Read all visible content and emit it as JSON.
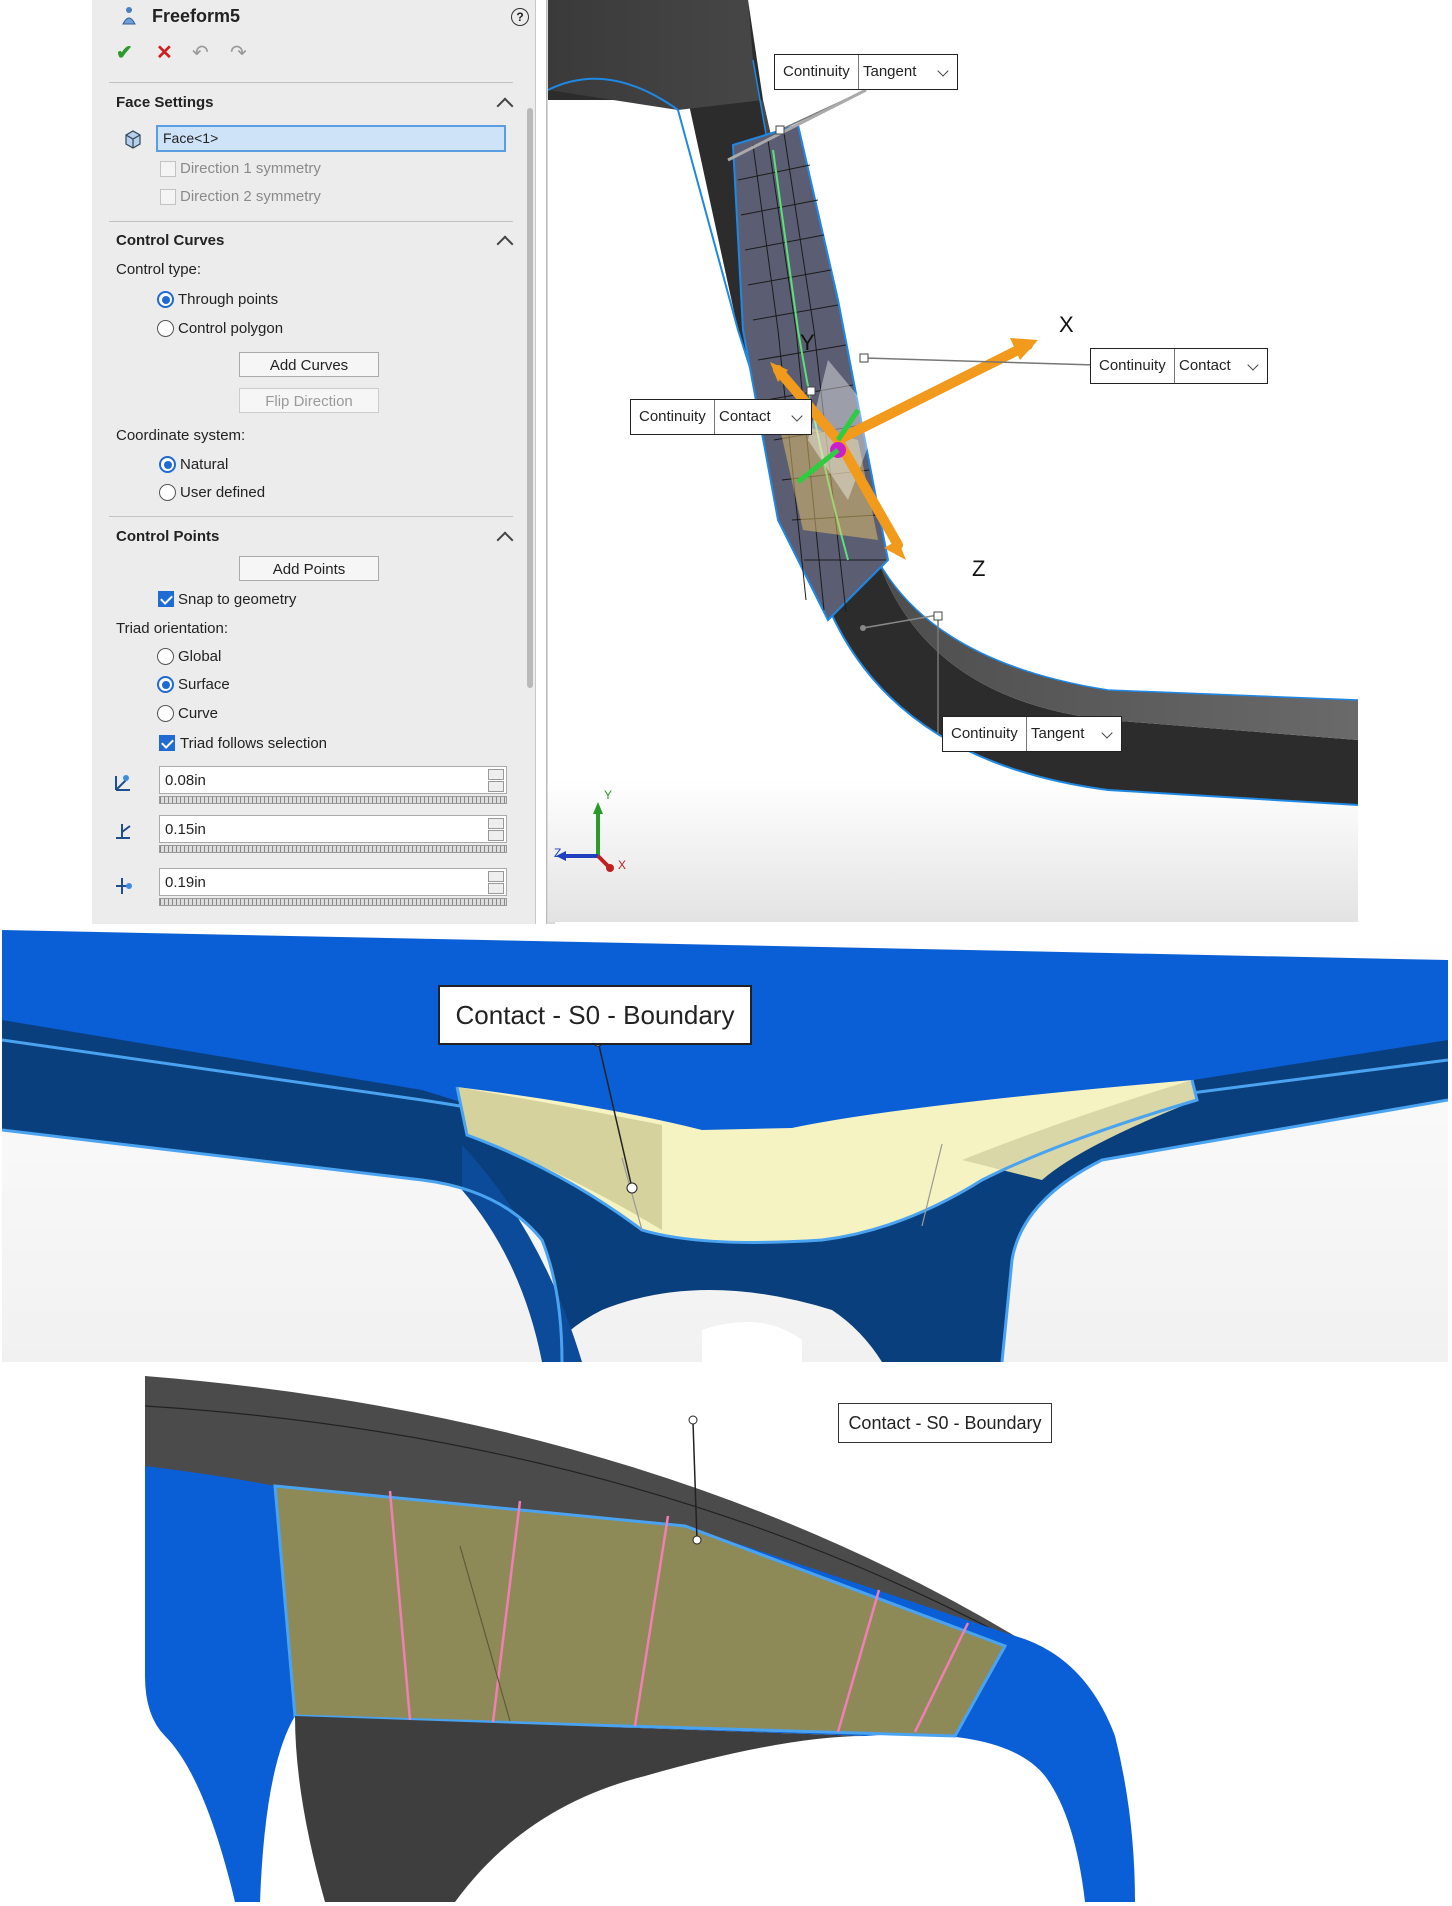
{
  "panel": {
    "title": "Freeform5",
    "help_symbol": "?",
    "toolbar": {
      "ok": "✔",
      "cancel": "✕",
      "undo": "↶",
      "redo": "↷"
    },
    "face_settings": {
      "header": "Face Settings",
      "face_value": "Face<1>",
      "dir1": "Direction 1 symmetry",
      "dir2": "Direction 2 symmetry"
    },
    "control_curves": {
      "header": "Control Curves",
      "control_type_label": "Control type:",
      "through_points": "Through points",
      "control_polygon": "Control polygon",
      "add_curves": "Add Curves",
      "flip_direction": "Flip Direction",
      "coord_label": "Coordinate system:",
      "natural": "Natural",
      "user_defined": "User defined"
    },
    "control_points": {
      "header": "Control Points",
      "add_points": "Add Points",
      "snap": "Snap to geometry",
      "triad_label": "Triad orientation:",
      "global": "Global",
      "surface": "Surface",
      "curve": "Curve",
      "triad_follows": "Triad follows selection",
      "values": [
        "0.08in",
        "0.15in",
        "0.19in"
      ]
    }
  },
  "viewport1": {
    "callouts": [
      {
        "label": "Continuity",
        "value": "Tangent"
      },
      {
        "label": "Continuity",
        "value": "Contact"
      },
      {
        "label": "Continuity",
        "value": "Contact"
      },
      {
        "label": "Continuity",
        "value": "Tangent"
      }
    ],
    "axes": {
      "x": "X",
      "y": "Y",
      "z": "Z"
    },
    "triad_small": {
      "y": "Y",
      "z": "Z",
      "x": "X"
    }
  },
  "viewport2": {
    "callout": "Contact - S0 - Boundary"
  },
  "viewport3": {
    "callout": "Contact - S0 - Boundary"
  },
  "colors": {
    "accent_blue": "#1f6ad3",
    "part_blue": "#0b5fd6",
    "part_dark_blue": "#0a3f7d",
    "edge_highlight": "#4aa3f0",
    "surface_yellow": "#f6f3c2",
    "surface_olive": "#8d8a58",
    "part_gray": "#4b4b4b",
    "triad_orange": "#f29a1c"
  }
}
